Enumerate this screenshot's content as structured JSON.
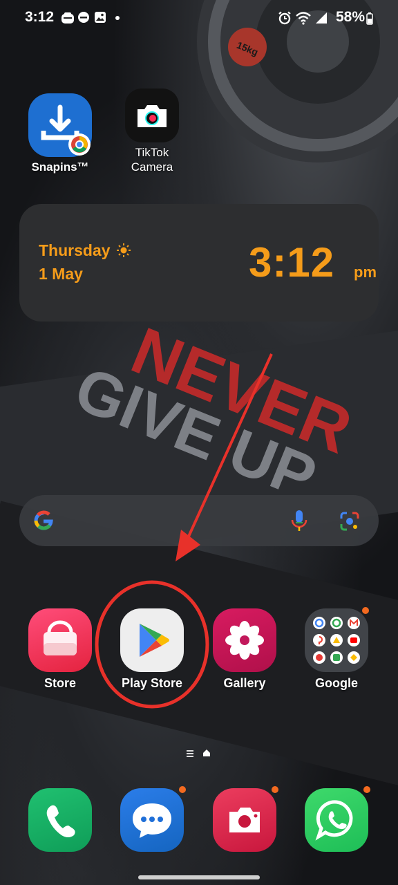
{
  "status_bar": {
    "time": "3:12",
    "battery_percent": "58%",
    "left_icons": [
      "app-notification-icon",
      "dnd-icon",
      "gallery-icon",
      "more-dot-icon"
    ],
    "right_icons": [
      "alarm-icon",
      "wifi-icon",
      "signal-icon",
      "battery-icon"
    ]
  },
  "wallpaper": {
    "text_line1": "NEVER",
    "text_line2": "GIVE UP",
    "plate_text": "15kg"
  },
  "top_apps": [
    {
      "label": "Snapins™",
      "icon": "download-chrome-icon"
    },
    {
      "label_line1": "TikTok",
      "label_line2": "Camera",
      "icon": "camera-icon"
    }
  ],
  "clock_widget": {
    "day": "Thursday",
    "date": "1 May",
    "time": "3:12",
    "ampm": "pm",
    "weather_icon": "sun-icon",
    "accent": "#f59c1a"
  },
  "search_bar": {
    "icons": [
      "google-g-icon",
      "microphone-icon",
      "lens-icon"
    ]
  },
  "home_apps": [
    {
      "label": "Store",
      "icon": "shopping-bag-icon"
    },
    {
      "label": "Play Store",
      "icon": "play-triangle-icon"
    },
    {
      "label": "Gallery",
      "icon": "flower-icon"
    },
    {
      "label": "Google",
      "icon": "folder-icon"
    }
  ],
  "dock_apps": [
    {
      "name": "Phone",
      "icon": "phone-icon"
    },
    {
      "name": "Messages",
      "icon": "chat-icon"
    },
    {
      "name": "Camera",
      "icon": "camera-icon"
    },
    {
      "name": "WhatsApp",
      "icon": "whatsapp-icon"
    }
  ],
  "annotation": {
    "color": "#e8312a",
    "description_icons": [
      "red-arrow",
      "red-circle"
    ]
  }
}
